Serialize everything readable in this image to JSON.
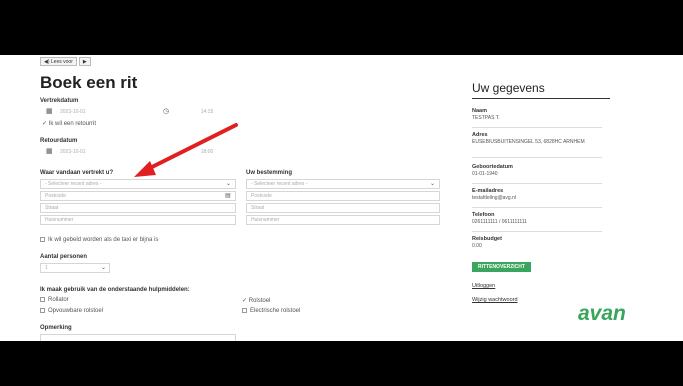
{
  "toolbar": {
    "read_label": "Lees voor",
    "play_label": "▶"
  },
  "form": {
    "title": "Boek een rit",
    "vertrekdatum_label": "Vertrekdatum",
    "vertrekdatum_value": "2023-10-01",
    "vertrektijd_value": "14:15",
    "retour_checkbox_label": "Ik wil een retourrit",
    "retourdatum_label": "Retourdatum",
    "retourdatum_value": "2023-10-01",
    "retourtijd_value": "18:00",
    "vertrek_label": "Waar vandaan vertrekt u?",
    "bestemming_label": "Uw bestemming",
    "select_recent": "- Selecteer recent adres -",
    "postcode_placeholder": "Postcode",
    "street_placeholder": "Straat",
    "housenumber_placeholder": "Huisnummer",
    "taxi_checkbox_label": "Ik wil gebeld worden als de taxi er bijna is",
    "aantal_label": "Aantal personen",
    "aantal_value": "1",
    "hulpmiddelen_label": "Ik maak gebruik van de onderstaande hulpmiddelen:",
    "hulp_rollator": "Rollator",
    "hulp_rolstoel": "Rolstoel",
    "hulp_opvouwbare": "Opvouwbare rolstoel",
    "hulp_elektrische": "Electrische rolstoel",
    "opmerking_label": "Opmerking"
  },
  "sidebar": {
    "title": "Uw gegevens",
    "naam_label": "Naam",
    "naam_value": "TESTPAS T.",
    "adres_label": "Adres",
    "adres_value": "EUSEBIUSBUITENSINGEL 53, 6828HC ARNHEM",
    "geboortedatum_label": "Geboortedatum",
    "geboortedatum_value": "01-01-1940",
    "email_label": "E-mailadres",
    "email_value": "testafdeling@avg.nl",
    "telefoon_label": "Telefoon",
    "telefoon_value": "0261111111 / 0611111111",
    "budget_label": "Reisbudget",
    "budget_value": "0.00",
    "badge_label": "RITTENOVERZICHT",
    "uitloggen_label": "Uitloggen",
    "wachtwoord_label": "Wijzig wachtwoord",
    "logo_text": "avan"
  },
  "colors": {
    "brand": "#3aa55c",
    "arrow": "#e02020"
  },
  "icons": {
    "calendar": "calendar-icon",
    "clock": "clock-icon",
    "chevron": "chevron-down-icon",
    "map": "map-icon",
    "speaker": "speaker-icon",
    "play": "play-icon"
  }
}
